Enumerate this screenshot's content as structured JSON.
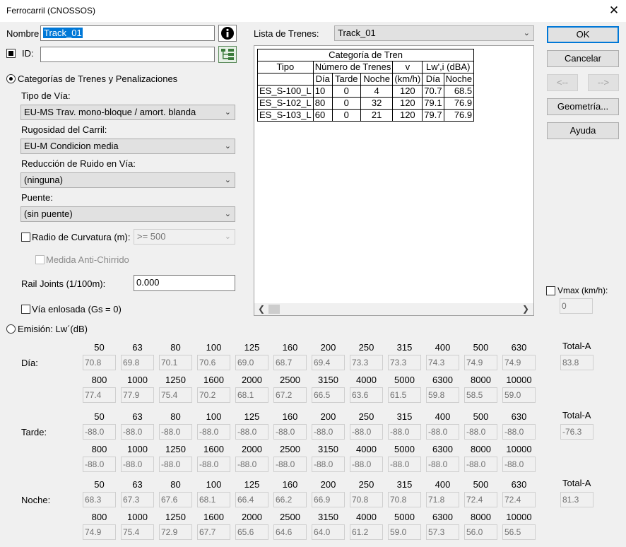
{
  "window": {
    "title": "Ferrocarril (CNOSSOS)",
    "close_glyph": "✕"
  },
  "nombre": {
    "label": "Nombre",
    "value": "Track_01"
  },
  "id_field": {
    "label": "ID:",
    "value": ""
  },
  "categorias_radio": {
    "label": "Categorías de Trenes y Penalizaciones"
  },
  "tipo_via": {
    "label": "Tipo de Vía:",
    "value": "EU-MS Trav. mono-bloque / amort. blanda"
  },
  "rugosidad": {
    "label": "Rugosidad del Carril:",
    "value": "EU-M Condicion media"
  },
  "reduccion": {
    "label": "Reducción de Ruido en Vía:",
    "value": "(ninguna)"
  },
  "puente": {
    "label": "Puente:",
    "value": "(sin puente)"
  },
  "radio_curvatura": {
    "label": "Radio de Curvatura (m):",
    "value": ">= 500"
  },
  "anti_chirrido": {
    "label": "Medida Anti-Chirrido"
  },
  "rail_joints": {
    "label": "Rail Joints (1/100m):",
    "value": "0.000"
  },
  "via_enlosada": {
    "label": "Vía enlosada (Gs = 0)"
  },
  "lista_trenes": {
    "label": "Lista de Trenes:",
    "value": "Track_01"
  },
  "train_table": {
    "header_top": "Categoría de Tren",
    "tipo": "Tipo",
    "numero": "Número de Trenes",
    "v": "v",
    "lw": "Lw',i (dBA)",
    "sub": [
      "Día",
      "Tarde",
      "Noche",
      "(km/h)",
      "Día",
      "Noche"
    ],
    "rows": [
      [
        "ES_S-100_L",
        "10",
        "0",
        "4",
        "120",
        "70.7",
        "68.5"
      ],
      [
        "ES_S-102_L",
        "80",
        "0",
        "32",
        "120",
        "79.1",
        "76.9"
      ],
      [
        "ES_S-103_L",
        "60",
        "0",
        "21",
        "120",
        "79.7",
        "76.9"
      ]
    ]
  },
  "buttons": {
    "ok": "OK",
    "cancel": "Cancelar",
    "prev": "<--",
    "next": "-->",
    "geometria": "Geometría...",
    "ayuda": "Ayuda"
  },
  "vmax": {
    "label": "Vmax (km/h):",
    "value": "0"
  },
  "emision": {
    "label": "Emisión: Lw´(dB)",
    "freqs_row1": [
      "50",
      "63",
      "80",
      "100",
      "125",
      "160",
      "200",
      "250",
      "315",
      "400",
      "500",
      "630"
    ],
    "freqs_row2": [
      "800",
      "1000",
      "1250",
      "1600",
      "2000",
      "2500",
      "3150",
      "4000",
      "5000",
      "6300",
      "8000",
      "10000"
    ],
    "total_label": "Total-A",
    "periods": [
      {
        "label": "Día:",
        "row1": [
          "70.8",
          "69.8",
          "70.1",
          "70.6",
          "69.0",
          "68.7",
          "69.4",
          "73.3",
          "73.3",
          "74.3",
          "74.9",
          "74.9"
        ],
        "row2": [
          "77.4",
          "77.9",
          "75.4",
          "70.2",
          "68.1",
          "67.2",
          "66.5",
          "63.6",
          "61.5",
          "59.8",
          "58.5",
          "59.0"
        ],
        "total": "83.8"
      },
      {
        "label": "Tarde:",
        "row1": [
          "-88.0",
          "-88.0",
          "-88.0",
          "-88.0",
          "-88.0",
          "-88.0",
          "-88.0",
          "-88.0",
          "-88.0",
          "-88.0",
          "-88.0",
          "-88.0"
        ],
        "row2": [
          "-88.0",
          "-88.0",
          "-88.0",
          "-88.0",
          "-88.0",
          "-88.0",
          "-88.0",
          "-88.0",
          "-88.0",
          "-88.0",
          "-88.0",
          "-88.0"
        ],
        "total": "-76.3"
      },
      {
        "label": "Noche:",
        "row1": [
          "68.3",
          "67.3",
          "67.6",
          "68.1",
          "66.4",
          "66.2",
          "66.9",
          "70.8",
          "70.8",
          "71.8",
          "72.4",
          "72.4"
        ],
        "row2": [
          "74.9",
          "75.4",
          "72.9",
          "67.7",
          "65.6",
          "64.6",
          "64.0",
          "61.2",
          "59.0",
          "57.3",
          "56.0",
          "56.5"
        ],
        "total": "81.3"
      }
    ]
  }
}
